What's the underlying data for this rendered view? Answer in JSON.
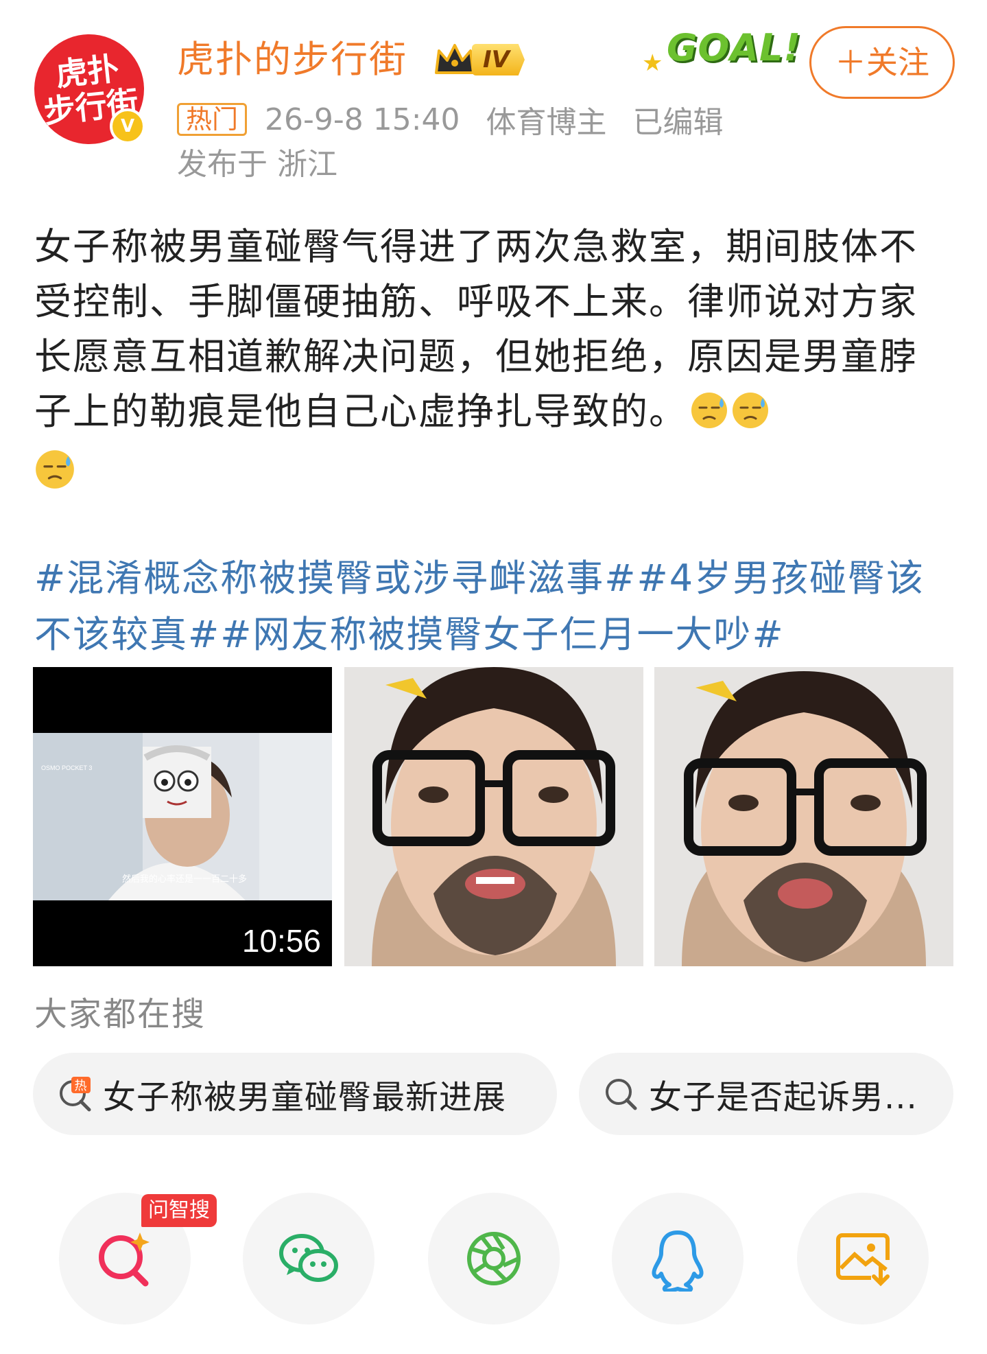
{
  "author": {
    "avatar_text": "虎扑\n步行街",
    "verified_badge": "V",
    "name": "虎扑的步行街",
    "level": "IV"
  },
  "decoration": {
    "goal_text": "GOAL!"
  },
  "follow_button": "＋关注",
  "meta": {
    "hot_tag": "热门",
    "time": "26-9-8 15:40",
    "category": "体育博主",
    "edited": "已编辑",
    "location": "发布于 浙江"
  },
  "post": {
    "text": "女子称被男童碰臀气得进了两次急救室，期间肢体不受控制、手脚僵硬抽筋、呼吸不上来。律师说对方家长愿意互相道歉解决问题，但她拒绝，原因是男童脖子上的勒痕是他自己心虚挣扎导致的。",
    "emoji_name": "sweat-emoji",
    "hashtags": "#混淆概念称被摸臀或涉寻衅滋事##4岁男孩碰臀该不该较真##网友称被摸臀女子仨月一大吵#"
  },
  "media": {
    "video_duration": "10:56",
    "video_caption": "然后我的心率还是一一百二十多",
    "video_watermark": "OSMO POCKET 3"
  },
  "search": {
    "title": "大家都在搜",
    "chips": [
      {
        "label": "女子称被男童碰臀最新进展",
        "icon": "hot-search-icon"
      },
      {
        "label": "女子是否起诉男...",
        "icon": "search-icon"
      }
    ]
  },
  "share": {
    "ask_badge": "问智搜",
    "buttons": [
      "ai-search-icon",
      "wechat-icon",
      "moments-icon",
      "qq-icon",
      "save-image-icon"
    ]
  },
  "colors": {
    "accent_orange": "#f07a2a",
    "hashtag_blue": "#3f77b2",
    "avatar_red": "#e8262e"
  }
}
